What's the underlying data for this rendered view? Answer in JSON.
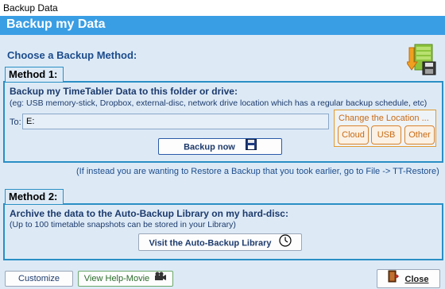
{
  "window": {
    "title": "Backup Data"
  },
  "header": {
    "title": "Backup my Data"
  },
  "main": {
    "choose_label": "Choose a Backup Method:",
    "logo_icon": "backup-folder-icon"
  },
  "method1": {
    "tab_label": "Method 1:",
    "heading": "Backup my TimeTabler Data to this folder or drive:",
    "hint": "(eg: USB memory-stick, Dropbox, external-disc, network drive location which has a regular backup schedule, etc)",
    "to_label": "To:",
    "to_value": "E:",
    "change_location_label": "Change the Location ...",
    "location_buttons": [
      "Cloud",
      "USB",
      "Other"
    ],
    "backup_button": "Backup now",
    "backup_icon": "floppy-disk-icon"
  },
  "restore_note": "(If instead you are wanting to Restore a Backup that you took earlier, go to File -> TT-Restore)",
  "method2": {
    "tab_label": "Method 2:",
    "heading": "Archive the data to the Auto-Backup Library on my hard-disc:",
    "hint": "(Up to 100 timetable snapshots can be stored in your Library)",
    "visit_button": "Visit the Auto-Backup Library",
    "visit_icon": "clock-icon"
  },
  "footer": {
    "customize_button": "Customize",
    "help_button": "View Help-Movie",
    "help_icon": "movie-camera-icon",
    "close_button": "Close",
    "close_icon": "exit-door-icon"
  },
  "colors": {
    "header_blue": "#3a9ee4",
    "panel_bg": "#ddeaf6",
    "border_blue": "#2a8fc4",
    "orange": "#d8822a"
  }
}
